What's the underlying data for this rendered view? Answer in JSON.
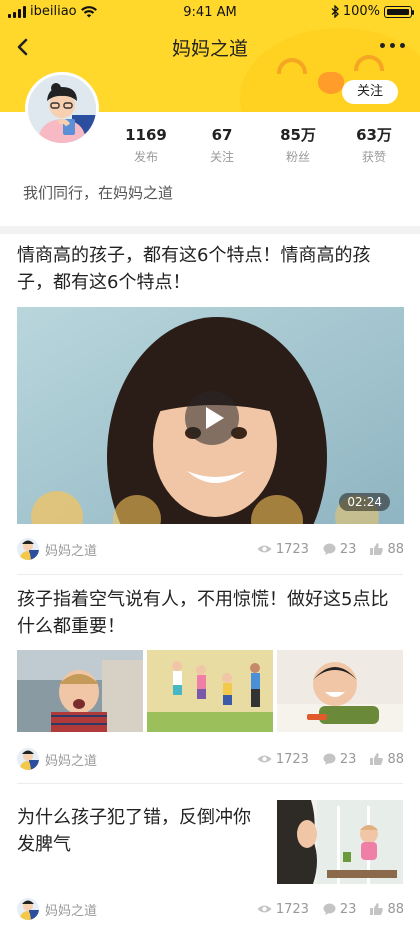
{
  "status": {
    "carrier": "ibeiliao",
    "time": "9:41 AM",
    "battery": "100%"
  },
  "nav": {
    "title": "妈妈之道",
    "follow_label": "关注"
  },
  "profile": {
    "stats": [
      {
        "value": "1169",
        "label": "发布"
      },
      {
        "value": "67",
        "label": "关注"
      },
      {
        "value": "85万",
        "label": "粉丝"
      },
      {
        "value": "63万",
        "label": "获赞"
      }
    ],
    "bio": "我们同行，在妈妈之道"
  },
  "articles": [
    {
      "title": "情商高的孩子，都有这6个特点！情商高的孩子，都有这6个特点！",
      "duration": "02:24",
      "source": "妈妈之道",
      "views": "1723",
      "comments": "23",
      "likes": "88"
    },
    {
      "title": "孩子指着空气说有人，不用惊慌！做好这5点比什么都重要！",
      "source": "妈妈之道",
      "views": "1723",
      "comments": "23",
      "likes": "88"
    },
    {
      "title": "为什么孩子犯了错，反倒冲你发脾气",
      "source": "妈妈之道",
      "views": "1723",
      "comments": "23",
      "likes": "88"
    }
  ]
}
